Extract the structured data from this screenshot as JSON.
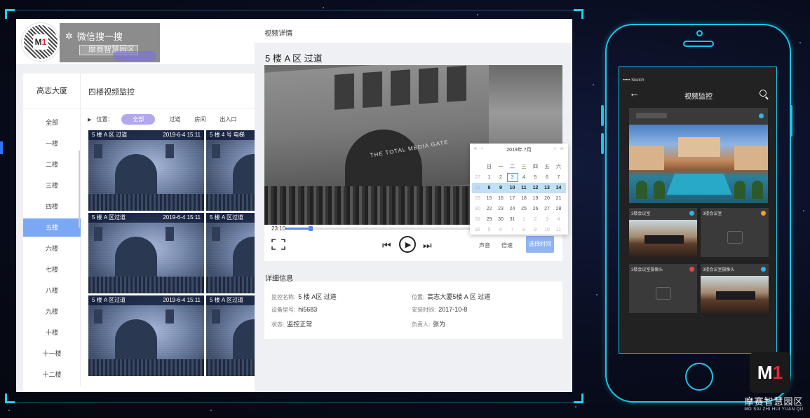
{
  "left_app": {
    "wechat": {
      "title": "微信搜一搜",
      "search_text": "摩赛智慧园区"
    },
    "building": "高志大厦",
    "floors": [
      "全部",
      "一楼",
      "二楼",
      "三楼",
      "四楼",
      "五楼",
      "六楼",
      "七楼",
      "八楼",
      "九楼",
      "十楼",
      "十一楼",
      "十二楼"
    ],
    "active_floor": "五楼",
    "content_title": "四楼视频监控",
    "filter": {
      "label": "位置：",
      "options": [
        "全部",
        "过道",
        "房间",
        "出入口"
      ],
      "active": "全部"
    },
    "videos": [
      {
        "name": "5 楼 A 区 过道",
        "time": "2019-6-4 15:11"
      },
      {
        "name": "5 楼 4 号 电梯",
        "time": ""
      },
      {
        "name": "5 楼 A 区过道",
        "time": "2019-6-4 15:11"
      },
      {
        "name": "5 楼 A 区过道",
        "time": ""
      },
      {
        "name": "5 楼 A 区过道",
        "time": "2019-6-4 15:11"
      },
      {
        "name": "5 楼 A 区过道",
        "time": ""
      }
    ]
  },
  "detail": {
    "header": "视频详情",
    "title": "5 楼 A 区 过道",
    "video_overlay_text": "THE TOTAL MEDIA GATE",
    "player": {
      "time": "23:10",
      "progress": 0.1,
      "sound": "声音",
      "speed": "倍速",
      "select_time": "选择时间"
    },
    "info_heading": "详细信息",
    "info": {
      "name_label": "监控名称:",
      "name": "5 楼 A区 过道",
      "location_label": "位置:",
      "location": "高志大厦5楼 A 区 过道",
      "model_label": "设备型号:",
      "model": "hi5683",
      "install_label": "安装时间:",
      "install": "2017-10-8",
      "status_label": "状态:",
      "status": "监控正常",
      "owner_label": "负责人:",
      "owner": "张为"
    }
  },
  "calendar": {
    "title": "2019年 7月",
    "weekdays": [
      "日",
      "一",
      "二",
      "三",
      "四",
      "五",
      "六"
    ],
    "weeks": [
      [
        "27",
        "1",
        "2",
        "3",
        "4",
        "5",
        "6",
        "7"
      ],
      [
        "28",
        "8",
        "9",
        "10",
        "11",
        "12",
        "13",
        "14"
      ],
      [
        "29",
        "15",
        "16",
        "17",
        "18",
        "19",
        "20",
        "21"
      ],
      [
        "30",
        "22",
        "23",
        "24",
        "25",
        "26",
        "27",
        "28"
      ],
      [
        "31",
        "29",
        "30",
        "31",
        "1",
        "2",
        "3",
        "4"
      ],
      [
        "32",
        "5",
        "6",
        "7",
        "8",
        "9",
        "10",
        "11"
      ]
    ],
    "today": "3",
    "selected_week": 1
  },
  "phone": {
    "status": "••••• Sketch",
    "title": "视频监控",
    "cameras": [
      {
        "name": "3楼会议室",
        "dot": "#2fb4e8"
      },
      {
        "name": "3楼会议室",
        "dot": "#f0a030"
      },
      {
        "name": "3楼会议室摄像头",
        "dot": "#e04848"
      },
      {
        "name": "3楼会议室摄像头",
        "dot": "#2fb4e8"
      }
    ]
  },
  "brand": {
    "logo_text": "M1",
    "cn": "摩赛智慧园区",
    "en": "MO SAI ZHI HUI YUAN QU"
  }
}
